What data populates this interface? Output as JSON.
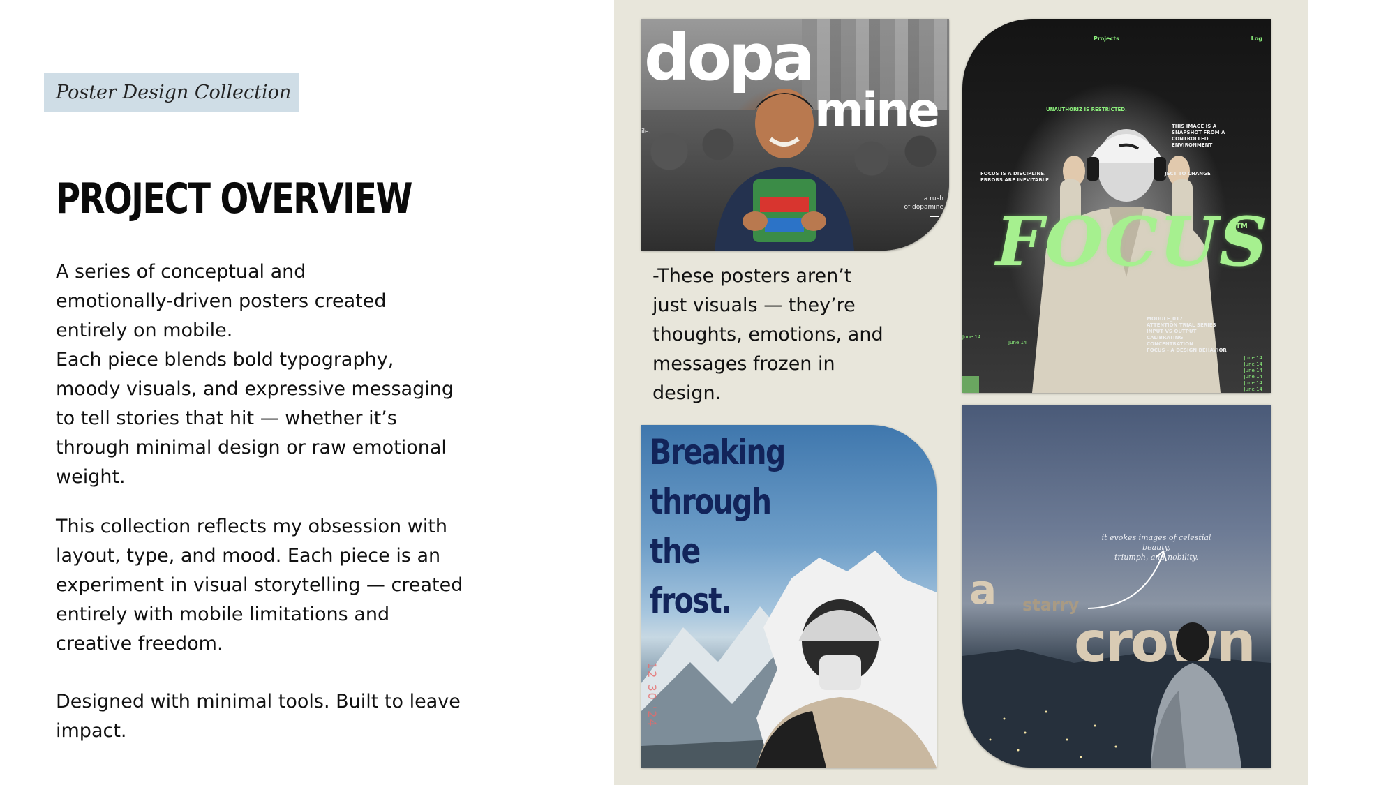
{
  "header": {
    "collection_label": "Poster Design Collection"
  },
  "overview": {
    "title": "PROJECT OVERVIEW",
    "paragraph_1": "A series of conceptual and\nemotionally-driven posters created\nentirely on mobile.\nEach piece blends bold typography,\nmoody visuals, and expressive messaging\nto tell stories that hit — whether it’s\nthrough minimal design or raw emotional\nweight.",
    "paragraph_2": "This collection reflects my obsession with\nlayout, type, and mood. Each piece is an\nexperiment in visual storytelling — created\nentirely with mobile limitations and\ncreative freedom.",
    "paragraph_3": "Designed with minimal tools. Built to leave\nimpact."
  },
  "gallery": {
    "caption": "-These posters aren’t\njust visuals — they’re\nthoughts, emotions, and\nmessages frozen in\ndesign.",
    "background_color": "#e8e6db",
    "posters": {
      "dopamine": {
        "word_top": "dopa",
        "word_bottom": "mine",
        "tag_left": "ile.",
        "tagline": "a rush\nof dopamine"
      },
      "focus": {
        "nav_projects": "Projects",
        "nav_log": "Log",
        "restricted": "UNAUTHORIZ          IS RESTRICTED.",
        "snapshot": "THIS IMAGE IS A\nSNAPSHOT FROM A\nCONTROLLED\nENVIRONMENT",
        "discipline": "FOCUS IS A DISCIPLINE.\nERRORS ARE INEVITABLE",
        "subject": "JECT TO CHANGE",
        "title": "FOCUS",
        "trademark": "TM",
        "module": "MODULE_017\nATTENTION TRIAL SERIES\nINPUT VS OUTPUT\nCALIBRATING\nCONCENTRATION\nFOCUS - A DESIGN BEHAVIOR",
        "date_left": "June 14",
        "date_mid": "June 14",
        "date_list": "June 14\nJune 14\nJune 14\nJune 14\nJune 14\nJune 14",
        "accent_color": "#8cf07c"
      },
      "frost": {
        "headline": "Breaking\nthrough the\nfrost.",
        "stamp": "12 30 '24",
        "headline_color": "#12245a"
      },
      "crown": {
        "quote": "it evokes images of celestial beauty,\ntriumph, and nobility.",
        "word_a": "a",
        "word_starry": "starry",
        "word_crown": "crown"
      }
    }
  }
}
